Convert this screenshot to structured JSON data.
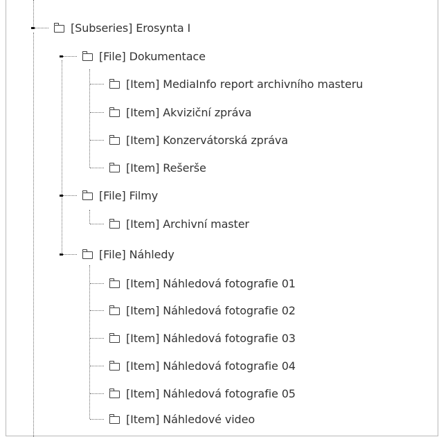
{
  "tree": {
    "subseries": {
      "label": "[Subseries] Erosynta I"
    },
    "files": [
      {
        "label": "[File] Dokumentace",
        "items": [
          {
            "label": "[Item] MediaInfo report archivního masteru"
          },
          {
            "label": "[Item] Akviziční zpráva"
          },
          {
            "label": "[Item] Konzervátorská zpráva"
          },
          {
            "label": "[Item] Rešerše"
          }
        ]
      },
      {
        "label": "[File] Filmy",
        "items": [
          {
            "label": "[Item] Archivní master"
          }
        ]
      },
      {
        "label": "[File] Náhledy",
        "items": [
          {
            "label": "[Item] Náhledová fotografie 01"
          },
          {
            "label": "[Item] Náhledová fotografie 02"
          },
          {
            "label": "[Item] Náhledová fotografie 03"
          },
          {
            "label": "[Item] Náhledová fotografie 04"
          },
          {
            "label": "[Item] Náhledová fotografie 05"
          },
          {
            "label": "[Item] Náhledové video"
          }
        ]
      }
    ]
  },
  "colors": {
    "text": "#333333",
    "connector": "#6a6a6a",
    "expander": "#111111",
    "border": "#b8b8b8"
  },
  "icons": {
    "node": "folder-icon",
    "expander": "expanded-toggle-icon"
  }
}
